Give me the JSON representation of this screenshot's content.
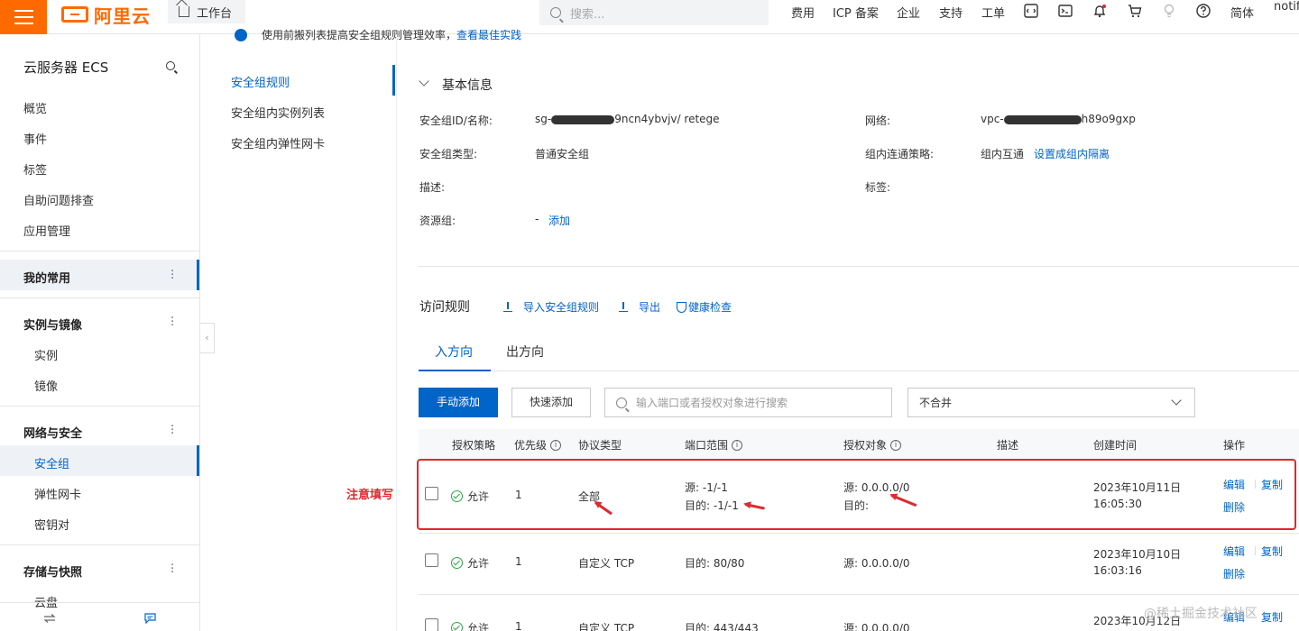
{
  "topbar": {
    "logo_text": "阿里云",
    "workbench": "工作台",
    "search_placeholder": "搜索...",
    "nav": [
      "费用",
      "ICP 备案",
      "企业",
      "支持",
      "工单"
    ],
    "lang": "简体",
    "user_partial": "notif"
  },
  "notice": {
    "text": "使用前搬列表提高安全组规则管理效率，",
    "link": "查看最佳实践"
  },
  "sidebar": {
    "title": "云服务器 ECS",
    "items": [
      "概览",
      "事件",
      "标签",
      "自助问题排查",
      "应用管理"
    ],
    "groups": {
      "favorites": "我的常用",
      "instances": "实例与镜像",
      "network": "网络与安全",
      "storage": "存储与快照"
    },
    "instance_sub": [
      "实例",
      "镜像"
    ],
    "network_sub": [
      "安全组",
      "弹性网卡",
      "密钥对"
    ],
    "storage_sub": [
      "云盘"
    ]
  },
  "subnav": [
    "安全组规则",
    "安全组内实例列表",
    "安全组内弹性网卡"
  ],
  "basic_info": {
    "title": "基本信息",
    "id_label": "安全组ID/名称:",
    "id_value_prefix": "sg-",
    "id_value_suffix": "9ncn4ybvjv/ retege",
    "network_label": "网络:",
    "network_prefix": "vpc-",
    "network_suffix": "h89o9gxp",
    "type_label": "安全组类型:",
    "type_value": "普通安全组",
    "policy_label": "组内连通策略:",
    "policy_value": "组内互通",
    "policy_link": "设置成组内隔离",
    "desc_label": "描述:",
    "tag_label": "标签:",
    "resgroup_label": "资源组:",
    "resgroup_value": "-",
    "resgroup_link": "添加"
  },
  "rules": {
    "title": "访问规则",
    "import": "导入安全组规则",
    "export": "导出",
    "health": "健康检查",
    "tab_in": "入方向",
    "tab_out": "出方向",
    "btn_manual": "手动添加",
    "btn_quick": "快速添加",
    "search_placeholder": "输入端口或者授权对象进行搜索",
    "select_value": "不合并",
    "headers": [
      "授权策略",
      "优先级",
      "协议类型",
      "端口范围",
      "授权对象",
      "描述",
      "创建时间",
      "操作"
    ],
    "info_glyph": "i",
    "edit": "编辑",
    "copy": "复制",
    "delete": "删除",
    "rows": [
      {
        "policy": "允许",
        "priority": "1",
        "protocol": "全部",
        "port1": "源: -1/-1",
        "port2": "目的: -1/-1",
        "target1": "源: 0.0.0.0/0",
        "target2": "目的:",
        "date": "2023年10月11日",
        "time": "16:05:30"
      },
      {
        "policy": "允许",
        "priority": "1",
        "protocol": "自定义 TCP",
        "port1": "目的: 80/80",
        "port2": "",
        "target1": "源: 0.0.0.0/0",
        "target2": "",
        "date": "2023年10月10日",
        "time": "16:03:16"
      },
      {
        "policy": "允许",
        "priority": "1",
        "protocol": "自定义 TCP",
        "port1": "目的: 443/443",
        "port2": "",
        "target1": "源: 0.0.0.0/0",
        "target2": "",
        "date": "2023年10月12日",
        "time": ""
      }
    ]
  },
  "annotation": "注意填写",
  "watermark": "@稀土掘金技术社区"
}
